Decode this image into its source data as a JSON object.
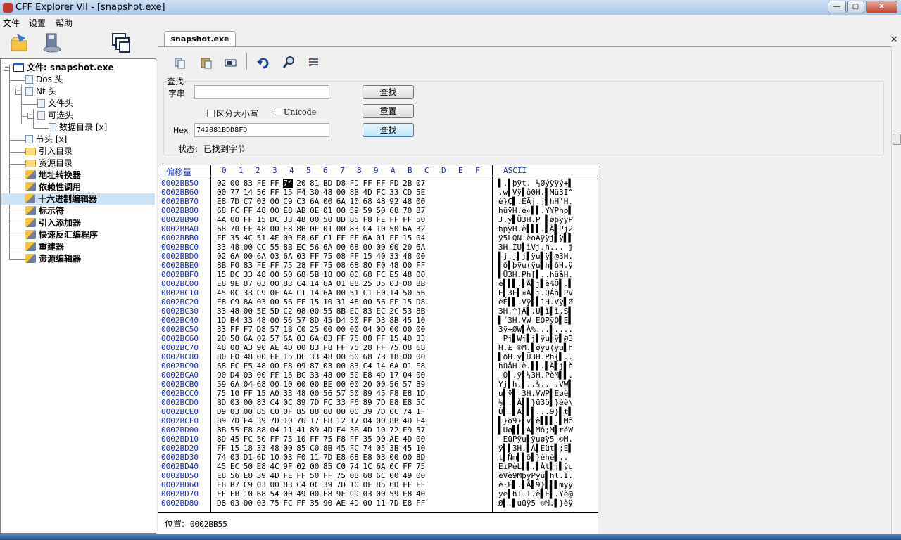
{
  "window": {
    "title": "CFF Explorer VII - [snapshot.exe]",
    "minimize": "—",
    "maximize": "▢",
    "close": "X"
  },
  "menu": [
    "文件",
    "设置",
    "帮助"
  ],
  "tree": {
    "root": "文件: snapshot.exe",
    "items": [
      {
        "label": "Dos 头"
      },
      {
        "label": "Nt 头"
      },
      {
        "label": "文件头"
      },
      {
        "label": "可选头"
      },
      {
        "label": "数据目录 [x]"
      },
      {
        "label": "节头 [x]"
      },
      {
        "label": "引入目录"
      },
      {
        "label": "资源目录"
      },
      {
        "label": "地址转换器"
      },
      {
        "label": "依赖性调用"
      },
      {
        "label": "十六进制编辑器"
      },
      {
        "label": "标示符"
      },
      {
        "label": "引入添加器"
      },
      {
        "label": "快速反汇编程序"
      },
      {
        "label": "重建器"
      },
      {
        "label": "资源编辑器"
      }
    ]
  },
  "tab": {
    "label": "snapshot.exe",
    "close": "×"
  },
  "find": {
    "section_label": "查找",
    "string_label": "字串",
    "string_value": "",
    "find_button": "查找",
    "case_label": "区分大小写",
    "unicode_label": "Unicode",
    "reset_button": "重置",
    "hex_label": "Hex",
    "hex_value": "742081BDD8FD",
    "hex_find_button": "查找",
    "status_label": "状态:",
    "status_value": "已找到字节"
  },
  "hex": {
    "offset_header": "偏移量",
    "byte_headers": [
      "0",
      "1",
      "2",
      "3",
      "4",
      "5",
      "6",
      "7",
      "8",
      "9",
      "A",
      "B",
      "C",
      "D",
      "E",
      "F"
    ],
    "ascii_header": "ASCII",
    "rows": [
      {
        "off": "0002BB50",
        "bytes": "02 00 83 FE FF",
        "cur": "74",
        "rest": " 20 81 BD D8 FD FF FF FD 2B 07",
        "ascii": "▌.▌þÿt. ½Øýÿÿý+▌"
      },
      {
        "off": "0002BB60",
        "bytes": "00 77 14 56 FF 15 F4 30 48 00 8B 4D FC 33 CD 5E",
        "ascii": ".w▌Vÿ▌ô0H.▌Mü3Í^"
      },
      {
        "off": "0002BB70",
        "bytes": "E8 7D C7 03 00 C9 C3 6A 00 6A 10 68 48 92 48 00",
        "ascii": "è}Ç▌.ÉÃj.j▌hH'H."
      },
      {
        "off": "0002BB80",
        "bytes": "68 FC FF 48 00 E8 AB 0E 01 00 59 59 50 68 70 87",
        "ascii": "hüÿH.è«▌▌.YYPhp▌"
      },
      {
        "off": "0002BB90",
        "bytes": "4A 00 FF 15 DC 33 48 00 50 8D 85 F8 FE FF FF 50",
        "ascii": "J.ÿ▌Ü3H.P ▌øþÿÿP"
      },
      {
        "off": "0002BBA0",
        "bytes": "68 70 FF 48 00 E8 8B 0E 01 00 83 C4 10 50 6A 32",
        "ascii": "hpÿH.è▌▌▌.▌Ä▌Pj2"
      },
      {
        "off": "0002BBB0",
        "bytes": "FF 35 4C 51 4E 00 E8 6F C1 FF FF 6A 01 FF 15 04",
        "ascii": "ÿ5LQN.èoÁÿÿj▌ÿ▌▌"
      },
      {
        "off": "0002BBC0",
        "bytes": "33 48 00 CC 55 8B EC 56 6A 00 68 00 00 00 20 6A",
        "ascii": "3H.ÌU▌ìVj.h... j"
      },
      {
        "off": "0002BBD0",
        "bytes": "02 6A 00 6A 03 6A 03 FF 75 08 FF 15 40 33 48 00",
        "ascii": "▌j.j▌j▌ÿu▌ÿ▌@3H."
      },
      {
        "off": "0002BBE0",
        "bytes": "8B F0 83 FE FF 75 28 FF 75 08 68 80 F0 48 00 FF",
        "ascii": "▌ð▌þÿu(ÿu▌h▌ðH.ÿ"
      },
      {
        "off": "0002BBF0",
        "bytes": "15 DC 33 48 00 50 68 5B 18 00 00 68 FC E5 48 00",
        "ascii": "▌Ü3H.Ph[▌..hüåH."
      },
      {
        "off": "0002BC00",
        "bytes": "E8 9E 87 03 00 83 C4 14 6A 01 E8 25 D5 03 00 8B",
        "ascii": "è▌▌▌.▌Ä▌j▌è%Õ▌.▌"
      },
      {
        "off": "0002BC10",
        "bytes": "45 0C 33 C9 0F A4 C1 14 6A 00 51 C1 E0 14 50 56",
        "ascii": "E▌3É▌¤Á▌j.QÁà▌PV"
      },
      {
        "off": "0002BC20",
        "bytes": "E8 C9 8A 03 00 56 FF 15 10 31 48 00 56 FF 15 D8",
        "ascii": "èÉ▌▌.Vÿ▌▌1H.Vÿ▌Ø"
      },
      {
        "off": "0002BC30",
        "bytes": "33 48 00 5E 5D C2 08 00 55 8B EC 83 EC 2C 53 8B",
        "ascii": "3H.^]Â▌.U▌ì▌ì,S▌"
      },
      {
        "off": "0002BC40",
        "bytes": "1D B4 33 48 00 56 57 8D 45 D4 50 FF D3 8B 45 10",
        "ascii": "▌´3H.VW EÔPÿÓ▌E▌"
      },
      {
        "off": "0002BC50",
        "bytes": "33 FF F7 D8 57 1B C0 25 00 00 00 04 0D 00 00 00",
        "ascii": "3ÿ÷ØW▌À%...▌...."
      },
      {
        "off": "0002BC60",
        "bytes": "20 50 6A 02 57 6A 03 6A 03 FF 75 08 FF 15 40 33",
        " ascii": " Pj▌Wj▌j▌ÿu▌ÿ▌@3"
      },
      {
        "off": "0002BC70",
        "bytes": "48 00 A3 90 AE 4D 00 83 F8 FF 75 28 FF 75 08 68",
        "ascii": "H.£ ®M.▌øÿu(ÿu▌h"
      },
      {
        "off": "0002BC80",
        "bytes": "80 F0 48 00 FF 15 DC 33 48 00 50 68 7B 18 00 00",
        "ascii": "▌ðH.ÿ▌Ü3H.Ph{▌.."
      },
      {
        "off": "0002BC90",
        "bytes": "68 FC E5 48 00 E8 09 87 03 00 83 C4 14 6A 01 E8",
        "ascii": "hüåH.è.▌▌.▌Ä▌j▌è"
      },
      {
        "off": "0002BCA0",
        "bytes": "90 D4 03 00 FF 15 BC 33 48 00 50 E8 4D 17 04 00",
        "ascii": " Ô▌.ÿ▌¼3H.PèM▌▌."
      },
      {
        "off": "0002BCB0",
        "bytes": "59 6A 04 68 00 10 00 00 BE 00 00 20 00 56 57 89",
        "ascii": "Yj▌h.▌..¾.. .VW▌"
      },
      {
        "off": "0002BCC0",
        "bytes": "75 10 FF 15 A0 33 48 00 56 57 50 89 45 F8 E8 1D",
        "ascii": "u▌ÿ▌ 3H.VWP▌Eøè▌"
      },
      {
        "off": "0002BCD0",
        "bytes": "BD 03 00 83 C4 0C 89 7D FC 33 F6 89 7D E8 E8 5C",
        "ascii": "½▌.▌Ä▌▌}ü3ö▌}èè\\"
      },
      {
        "off": "0002BCE0",
        "bytes": "D9 03 00 85 C0 0F 85 88 00 00 00 39 7D 0C 74 1F",
        "ascii": "Ù▌.▌À▌▌▌...9}▌t▌"
      },
      {
        "off": "0002BCF0",
        "bytes": "89 7D F4 39 7D 10 76 17 E8 12 17 04 00 8B 4D F4",
        "ascii": "▌}ô9}▌v▌è▌▌▌.▌Mô"
      },
      {
        "off": "0002BD00",
        "bytes": "8B 55 F8 88 04 11 41 89 4D F4 3B 4D 10 72 E9 57",
        "ascii": "▌Uø▌▌▌A▌Mô;M▌réW"
      },
      {
        "off": "0002BD10",
        "bytes": "8D 45 FC 50 FF 75 10 FF 75 F8 FF 35 90 AE 4D 00",
        "ascii": " EüPÿu▌ÿuøÿ5 ®M."
      },
      {
        "off": "0002BD20",
        "bytes": "FF 15 18 33 48 00 85 C0 8B 45 FC 74 05 3B 45 10",
        "ascii": "ÿ▌▌3H.▌À▌Eüt▌;E▌"
      },
      {
        "off": "0002BD30",
        "bytes": "74 03 D1 6D 10 03 F0 11 7D E8 68 E8 03 00 00 8D",
        "ascii": "t▌Ñm▌▌ð▌}èhè▌.. "
      },
      {
        "off": "0002BD40",
        "bytes": "45 EC 50 E8 4C 9F 02 00 85 C0 74 1C 6A 0C FF 75",
        "ascii": "EìPèL▌▌.▌Àt▌j▌ÿu"
      },
      {
        "off": "0002BD50",
        "bytes": "E8 56 E8 39 4D FE FF 50 FF 75 08 68 6C 00 49 00",
        "ascii": "èVè9MþÿPÿu▌hl.I."
      },
      {
        "off": "0002BD60",
        "bytes": "E8 B7 C9 03 00 83 C4 0C 39 7D 10 0F 85 6D FF FF",
        "ascii": "è·É▌.▌Ä▌9}▌▌▌mÿÿ"
      },
      {
        "off": "0002BD70",
        "bytes": "FF EB 10 68 54 00 49 00 E8 9F C9 03 00 59 E8 40",
        "ascii": "ÿë▌hT.I.è▌É▌.Yè@"
      },
      {
        "off": "0002BD80",
        "bytes": "D8 03 00 03 75 FC FF 35 90 AE 4D 00 11 7D E8 FF",
        "ascii": "Ø▌.▌uüÿ5 ®M.▌}èÿ"
      }
    ],
    "position_label": "位置:",
    "position_value": "0002BB55"
  }
}
